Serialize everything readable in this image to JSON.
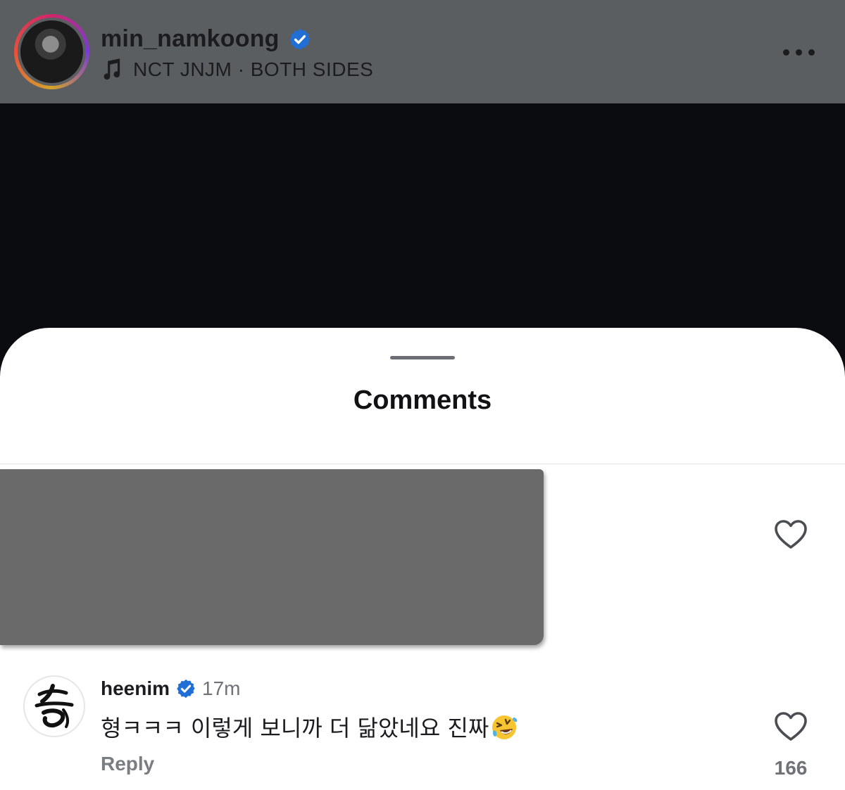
{
  "header": {
    "username": "min_namkoong",
    "audio_label": "NCT JNJM · BOTH SIDES"
  },
  "sheet": {
    "title": "Comments"
  },
  "comments": [
    {
      "username": "heenim",
      "time": "17m",
      "text": "형ㅋㅋㅋ 이렇게 보니까 더 닮았네요 진짜",
      "emoji": "🤣",
      "reply_label": "Reply",
      "like_count": "166"
    }
  ],
  "colors": {
    "header_bg": "#5b5e61",
    "verified_blue": "#1f6fd6",
    "sheet_bg": "#ffffff",
    "redacted_gray": "#6a6a6b"
  },
  "icons": [
    "verified-badge-icon",
    "music-note-icon",
    "more-options-icon",
    "heart-icon",
    "laughing-emoji-icon"
  ]
}
